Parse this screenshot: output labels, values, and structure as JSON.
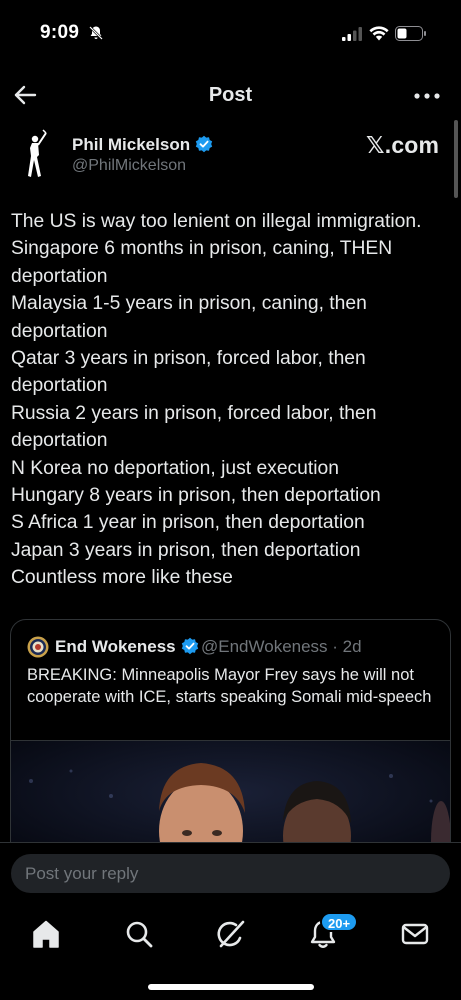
{
  "status_bar": {
    "time": "9:09",
    "icons": [
      "bell-slash-icon",
      "signal-icon",
      "wifi-icon",
      "battery-icon"
    ]
  },
  "header": {
    "title": "Post",
    "back_icon": "arrow-left-icon",
    "more_icon": "more-horizontal-icon"
  },
  "post": {
    "author": {
      "name": "Phil Mickelson",
      "handle": "@PhilMickelson",
      "verified": true,
      "avatar_icon": "golfer-silhouette-icon"
    },
    "source_badge": "𝕏.com",
    "lines": [
      "The US is way too lenient on illegal immigration.",
      "Singapore 6 months in prison, caning, THEN",
      "deportation",
      "Malaysia 1-5 years in prison, caning, then",
      "deportation",
      "Qatar 3 years in prison, forced labor, then",
      "deportation",
      "Russia 2 years in prison, forced labor, then",
      "deportation",
      "N Korea no deportation, just execution",
      "Hungary 8 years in prison, then deportation",
      "S Africa 1 year in prison, then deportation",
      "Japan 3 years in prison, then deportation",
      "Countless more like these"
    ]
  },
  "quote": {
    "author": {
      "name": "End Wokeness",
      "handle": "@EndWokeness",
      "verified": true
    },
    "time": "2d",
    "handle_time": "@EndWokeness · 2d",
    "text": "BREAKING: Minneapolis Mayor Frey says he will not cooperate with ICE, starts speaking Somali mid-speech"
  },
  "reply": {
    "placeholder": "Post your reply"
  },
  "tabbar": {
    "items": [
      "home-icon",
      "search-icon",
      "grok-icon",
      "notifications-icon",
      "messages-icon"
    ],
    "notifications_badge": "20+"
  },
  "colors": {
    "accent": "#1d9bf0",
    "background": "#000000",
    "text": "#e7e9ea",
    "muted": "#71767b",
    "border": "#2f3336"
  }
}
